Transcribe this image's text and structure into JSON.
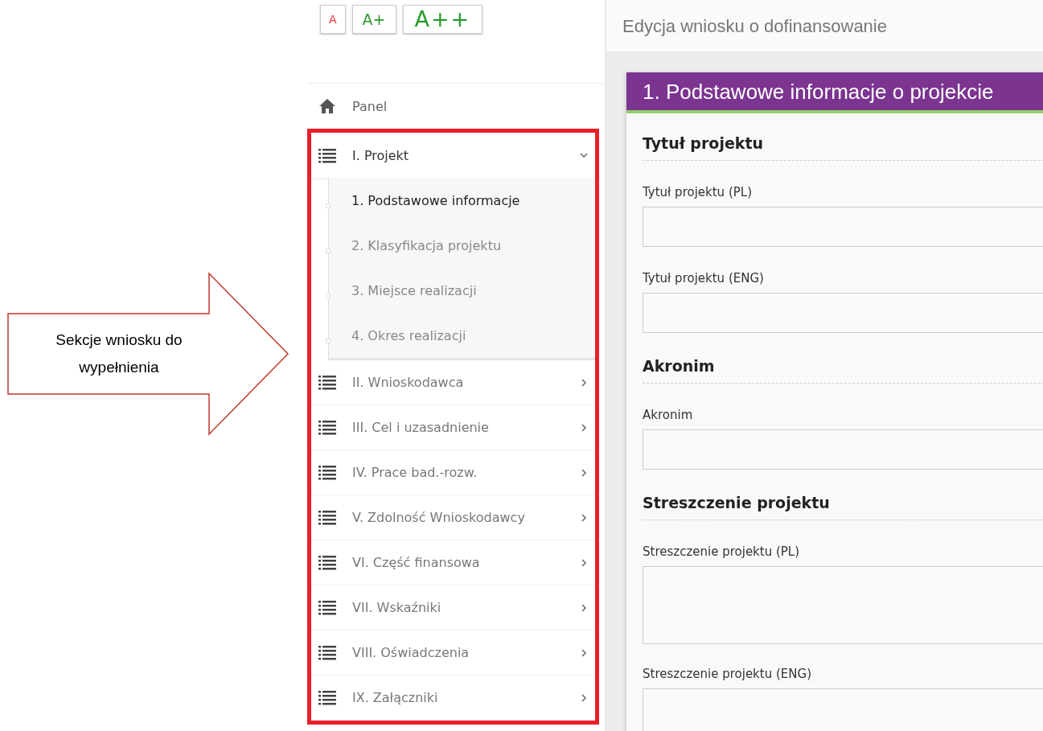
{
  "callout": {
    "text": "Sekcje wniosku do wypełnienia"
  },
  "font_size_buttons": [
    {
      "label": "A",
      "color": "#e8343c"
    },
    {
      "label": "A+",
      "color": "#2a9a2a"
    },
    {
      "label": "A++",
      "color": "#2a9a2a"
    }
  ],
  "sidebar": {
    "panel": {
      "label": "Panel"
    },
    "sections": [
      {
        "label": "I. Projekt",
        "expanded": true,
        "children": [
          {
            "label": "1. Podstawowe informacje",
            "selected": true
          },
          {
            "label": "2. Klasyfikacja projektu",
            "selected": false
          },
          {
            "label": "3. Miejsce realizacji",
            "selected": false
          },
          {
            "label": "4. Okres realizacji",
            "selected": false
          }
        ]
      },
      {
        "label": "II. Wnioskodawca",
        "expanded": false
      },
      {
        "label": "III. Cel i uzasadnienie",
        "expanded": false
      },
      {
        "label": "IV. Prace bad.-rozw.",
        "expanded": false
      },
      {
        "label": "V. Zdolność Wnioskodawcy",
        "expanded": false
      },
      {
        "label": "VI. Część finansowa",
        "expanded": false
      },
      {
        "label": "VII. Wskaźniki",
        "expanded": false
      },
      {
        "label": "VIII. Oświadczenia",
        "expanded": false
      },
      {
        "label": "IX. Załączniki",
        "expanded": false
      }
    ]
  },
  "main": {
    "title": "Edycja wniosku o dofinansowanie",
    "card_title": "1. Podstawowe informacje o projekcie",
    "sections": [
      {
        "heading": "Tytuł projektu",
        "fields": [
          {
            "label": "Tytuł projektu (PL)",
            "kind": "input"
          },
          {
            "label": "Tytuł projektu (ENG)",
            "kind": "input"
          }
        ]
      },
      {
        "heading": "Akronim",
        "fields": [
          {
            "label": "Akronim",
            "kind": "input"
          }
        ]
      },
      {
        "heading": "Streszczenie projektu",
        "fields": [
          {
            "label": "Streszczenie projektu (PL)",
            "kind": "textarea"
          },
          {
            "label": "Streszczenie projektu (ENG)",
            "kind": "textarea"
          }
        ]
      }
    ]
  }
}
